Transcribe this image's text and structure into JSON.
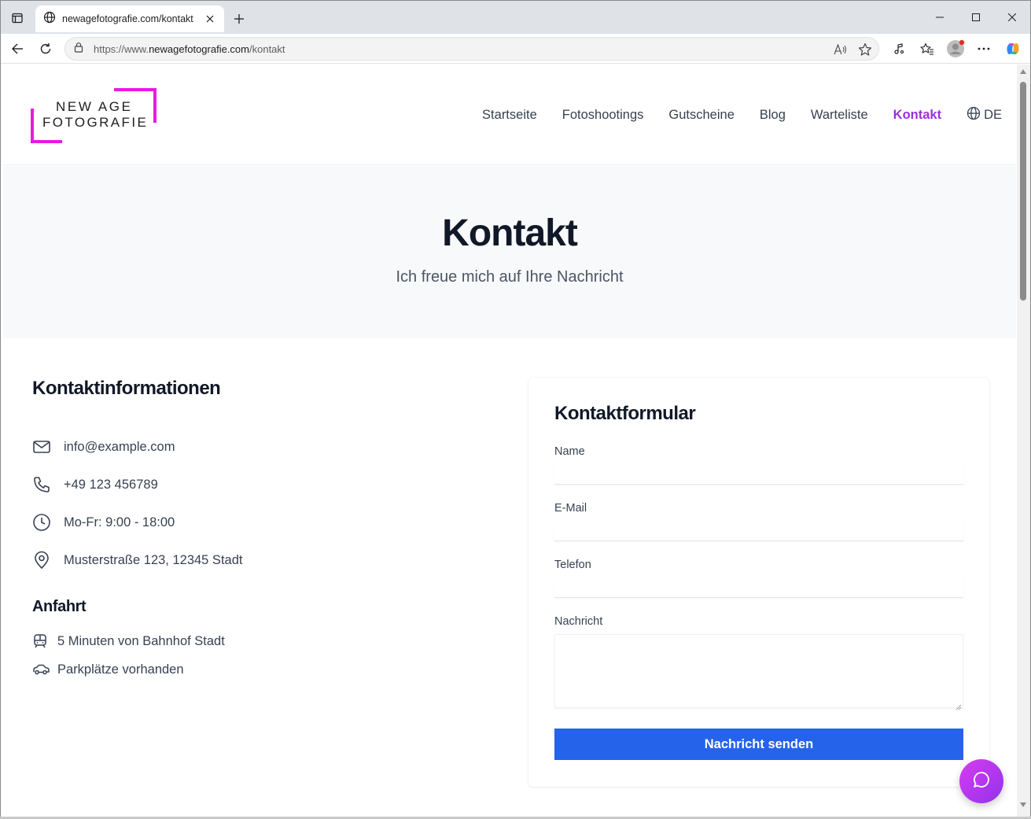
{
  "browser": {
    "tab_title": "newagefotografie.com/kontakt",
    "url_prefix": "https://www.",
    "url_host": "newagefotografie.com",
    "url_path": "/kontakt"
  },
  "site": {
    "logo_line1": "NEW AGE",
    "logo_line2": "FOTOGRAFIE",
    "accent_color": "#ea18e5",
    "nav": {
      "startseite": "Startseite",
      "fotoshootings": "Fotoshootings",
      "gutscheine": "Gutscheine",
      "blog": "Blog",
      "warteliste": "Warteliste",
      "kontakt": "Kontakt",
      "language": "DE"
    },
    "nav_active_color": "#9b30d9"
  },
  "hero": {
    "title": "Kontakt",
    "subtitle": "Ich freue mich auf Ihre Nachricht"
  },
  "info": {
    "heading": "Kontaktinformationen",
    "email": "info@example.com",
    "phone": "+49 123 456789",
    "hours": "Mo-Fr: 9:00 - 18:00",
    "address": "Musterstraße 123, 12345 Stadt",
    "arrival_heading": "Anfahrt",
    "arrival_train": "5 Minuten von Bahnhof Stadt",
    "arrival_parking": "Parkplätze vorhanden"
  },
  "form": {
    "heading": "Kontaktformular",
    "name_label": "Name",
    "email_label": "E-Mail",
    "phone_label": "Telefon",
    "message_label": "Nachricht",
    "name_value": "",
    "email_value": "",
    "phone_value": "",
    "message_value": "",
    "submit_label": "Nachricht senden",
    "submit_color": "#2563eb"
  },
  "icons": {
    "email": "mail-icon",
    "phone": "phone-icon",
    "hours": "clock-icon",
    "address": "map-pin-icon",
    "train": "train-icon",
    "parking": "car-icon",
    "chat": "chat-bubble-icon"
  }
}
